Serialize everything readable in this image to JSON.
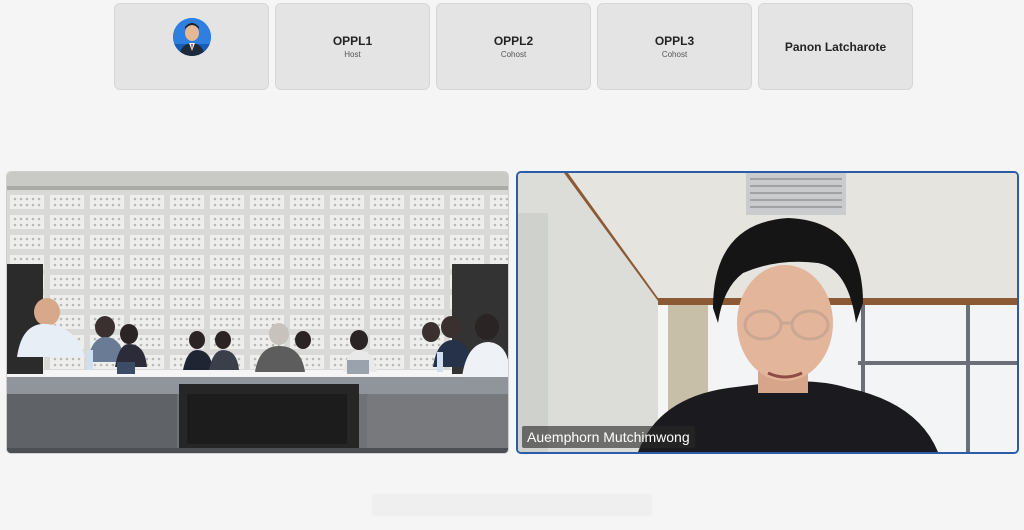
{
  "participants": [
    {
      "name": "",
      "role": "",
      "has_avatar": true
    },
    {
      "name": "OPPL1",
      "role": "Host"
    },
    {
      "name": "OPPL2",
      "role": "Cohost"
    },
    {
      "name": "OPPL3",
      "role": "Cohost"
    },
    {
      "name": "Panon Latcharote",
      "role": ""
    }
  ],
  "main_videos": {
    "left": {
      "label": ""
    },
    "right": {
      "label": "Auemphorn Mutchimwong",
      "active_speaker": true
    }
  },
  "colors": {
    "background": "#f5f5f5",
    "tile": "#e4e4e4",
    "active_speaker_border": "#2a5ca8"
  }
}
